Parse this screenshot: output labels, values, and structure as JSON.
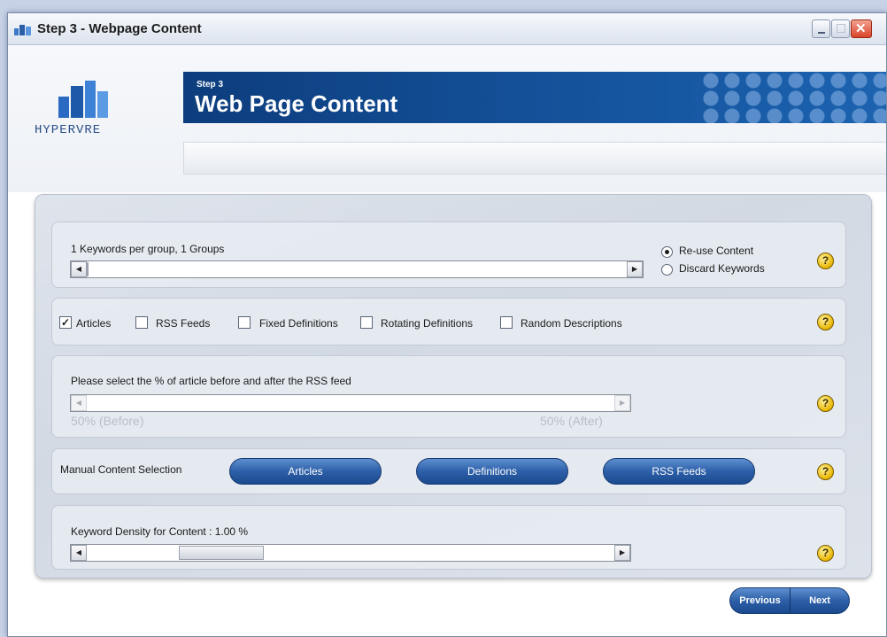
{
  "window": {
    "title": "Step 3 - Webpage Content",
    "close_glyph": "✕"
  },
  "header": {
    "logo_text": "HYPERVRE",
    "step_label": "Step 3",
    "title": "Web Page Content"
  },
  "keywords_section": {
    "label": "1 Keywords per group, 1 Groups",
    "radio_options": [
      {
        "label": "Re-use Content",
        "selected": true
      },
      {
        "label": "Discard Keywords",
        "selected": false
      }
    ]
  },
  "content_types": [
    {
      "label": "Articles",
      "checked": true
    },
    {
      "label": "RSS Feeds",
      "checked": false
    },
    {
      "label": "Fixed Definitions",
      "checked": false
    },
    {
      "label": "Rotating Definitions",
      "checked": false
    },
    {
      "label": "Random Descriptions",
      "checked": false
    }
  ],
  "rss_split": {
    "label": "Please select the % of article before and after the RSS feed",
    "before_label": "50% (Before)",
    "after_label": "50% (After)"
  },
  "manual_selection": {
    "label": "Manual Content Selection",
    "buttons": [
      "Articles",
      "Definitions",
      "RSS Feeds"
    ]
  },
  "density": {
    "label": "Keyword Density for Content : 1.00 %"
  },
  "help_glyph": "?",
  "scroll_left_glyph": "◀",
  "scroll_right_glyph": "▶",
  "checkmark_glyph": "✓",
  "nav": {
    "previous": "Previous",
    "next": "Next"
  },
  "colors": {
    "banner": "#15549e",
    "button": "#2d5fa8",
    "help": "#e9b600"
  }
}
